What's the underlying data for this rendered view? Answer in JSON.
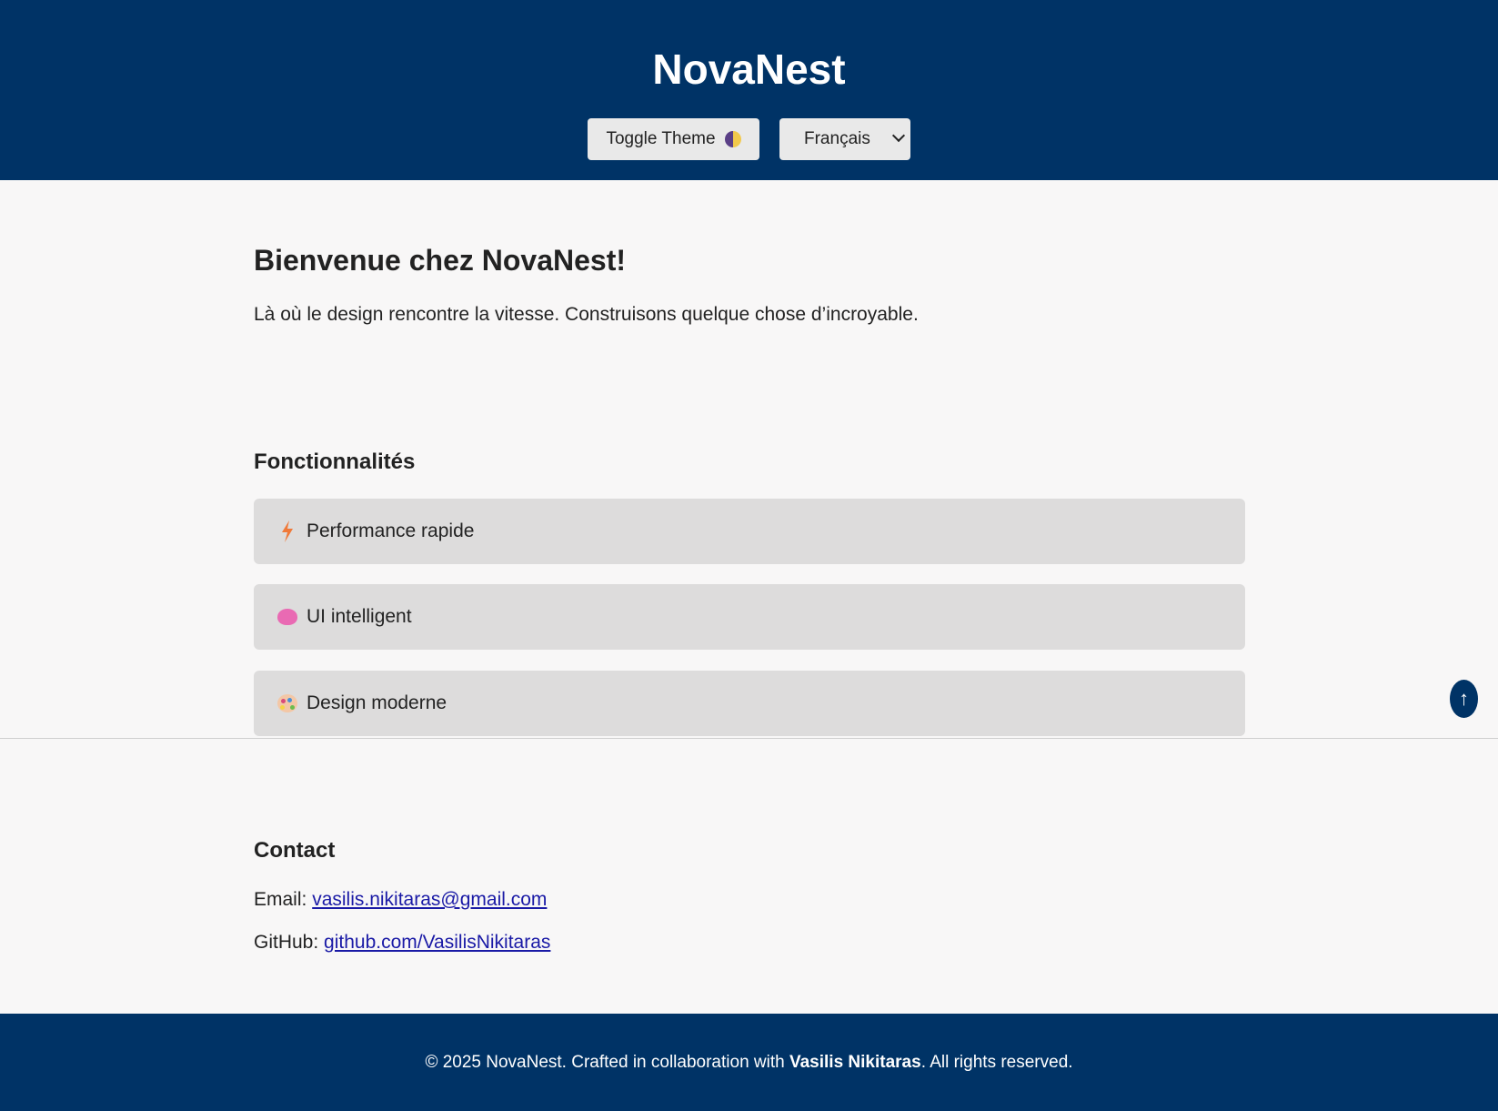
{
  "header": {
    "title": "NovaNest",
    "theme_button_label": "Toggle Theme",
    "theme_icon": "half-moon-icon",
    "language_selected": "Français"
  },
  "hero": {
    "title": "Bienvenue chez NovaNest!",
    "text": "Là où le design rencontre la vitesse. Construisons quelque chose d’incroyable."
  },
  "features": {
    "title": "Fonctionnalités",
    "items": [
      {
        "icon": "lightning-icon",
        "label": "Performance rapide"
      },
      {
        "icon": "brain-icon",
        "label": "UI intelligent"
      },
      {
        "icon": "palette-icon",
        "label": "Design moderne"
      }
    ]
  },
  "scroll_top": {
    "label": "↑"
  },
  "contact": {
    "title": "Contact",
    "email_label": "Email:",
    "email_value": "vasilis.nikitaras@gmail.com",
    "github_label": "GitHub:",
    "github_value": "github.com/VasilisNikitaras"
  },
  "footer": {
    "prefix": "© 2025 NovaNest. Crafted in collaboration with",
    "author": "Vasilis Nikitaras",
    "suffix": ". All rights reserved."
  },
  "colors": {
    "header_bg": "#003366",
    "page_bg": "#f8f7f7",
    "card_bg": "#dddcdc",
    "link": "#1a1aa6"
  }
}
